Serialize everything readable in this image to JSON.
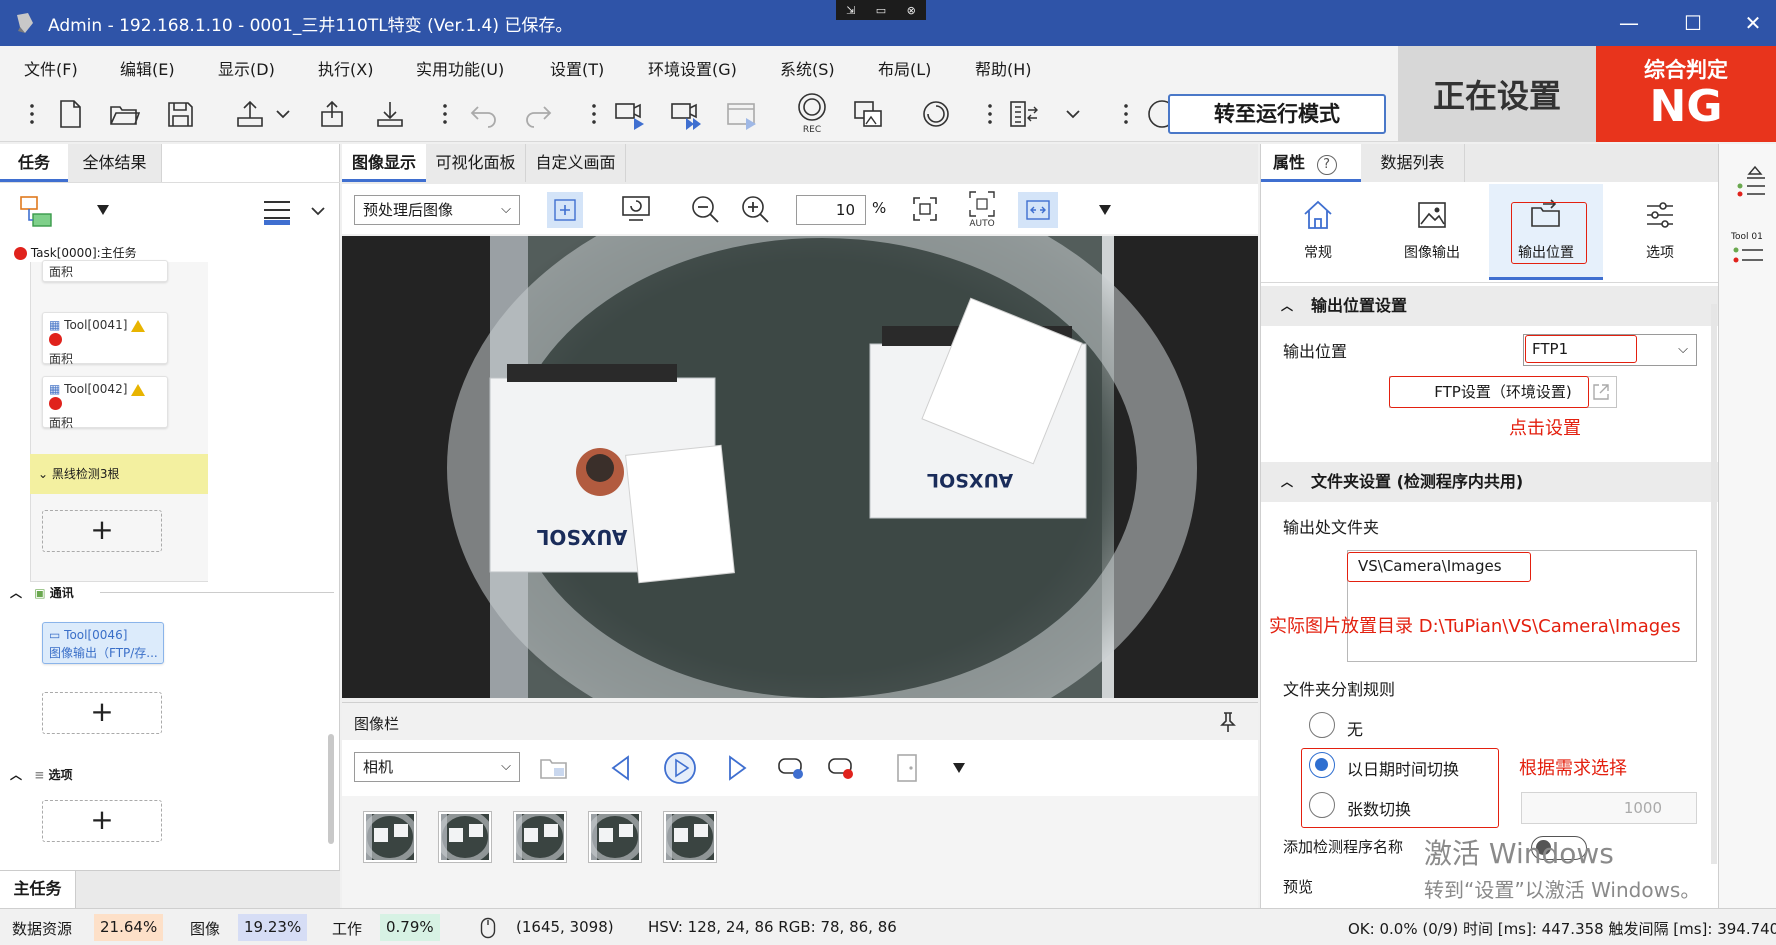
{
  "window": {
    "title": "Admin - 192.168.1.10 - 0001_三井110TL特变 (Ver.1.4) 已保存。",
    "minimize": "—",
    "maximize": "☐",
    "close": "✕"
  },
  "remote_bar": {
    "a": "⇲",
    "b": "▭",
    "c": "⊗"
  },
  "menu": [
    "文件(F)",
    "编辑(E)",
    "显示(D)",
    "执行(X)",
    "实用功能(U)",
    "设置(T)",
    "环境设置(G)",
    "系统(S)",
    "布局(L)",
    "帮助(H)"
  ],
  "toolbar": {
    "run_mode_label": "转至运行模式",
    "rec_label": "REC"
  },
  "status_box": {
    "setting_label": "正在设置"
  },
  "judge": {
    "title": "综合判定",
    "value": "NG"
  },
  "left_panel": {
    "tabs": [
      "任务",
      "全体结果"
    ],
    "task_label": "Task[0000]:主任务",
    "top_partial_label": "面积",
    "tools": [
      {
        "name": "Tool[0041]",
        "sub": "面积"
      },
      {
        "name": "Tool[0042]",
        "sub": "面积"
      }
    ],
    "group_label": "黑线检测3根",
    "comm_section": "通讯",
    "comm_tool": {
      "name": "Tool[0046]",
      "sub": "图像输出（FTP/存..."
    },
    "options_section": "选项",
    "plus": "+",
    "bottom_tab": "主任务"
  },
  "center": {
    "tabs": [
      "图像显示",
      "可视化面板",
      "自定义画面"
    ],
    "image_select": "预处理后图像",
    "zoom_value": "10",
    "zoom_unit": "%",
    "auto_label": "AUTO",
    "image_text_left": "AUXSOL",
    "image_text_right": "AUXSOL",
    "gallery_title": "图像栏",
    "camera_select": "相机",
    "thumb_count": 5
  },
  "right_panel": {
    "tabs": [
      "属性",
      "数据列表"
    ],
    "help_icon": "?",
    "categories": [
      "常规",
      "图像输出",
      "输出位置",
      "选项"
    ],
    "section1_title": "输出位置设置",
    "output_location_label": "输出位置",
    "output_location_value": "FTP1",
    "ftp_button": "FTP设置（环境设置)",
    "note_click": "点击设置",
    "section2_title": "文件夹设置 (检测程序内共用)",
    "output_folder_label": "输出处文件夹",
    "output_folder_value": "VS\\Camera\\Images",
    "note_actual_dir": "实际图片放置目录 D:\\TuPian\\VS\\Camera\\Images",
    "split_rule_label": "文件夹分割规则",
    "radio_options": [
      "无",
      "以日期时间切换",
      "张数切换"
    ],
    "radio_selected_index": 1,
    "note_choose": "根据需求选择",
    "count_value": "1000",
    "add_program_name_label": "添加检测程序名称",
    "preview_label": "预览"
  },
  "far_right": {
    "tool_label": "Tool 01"
  },
  "watermark": {
    "line1": "激活 Windows",
    "line2": "转到“设置”以激活 Windows。"
  },
  "statusbar": {
    "data_resource_label": "数据资源",
    "data_resource_pct": "21.64%",
    "image_label": "图像",
    "image_pct": "19.23%",
    "work_label": "工作",
    "work_pct": "0.79%",
    "coords": "(1645, 3098)",
    "pixel_info": "HSV: 128, 24, 86 RGB: 78, 86, 86",
    "right_info": "OK: 0.0% (0/9) 时间 [ms]: 447.358 触发间隔 [ms]: 394.740"
  },
  "colors": {
    "title_blue": "#2f54a8",
    "ng_red": "#e8341c",
    "note_red": "#e3200f",
    "accent_blue": "#3f6fd0"
  }
}
